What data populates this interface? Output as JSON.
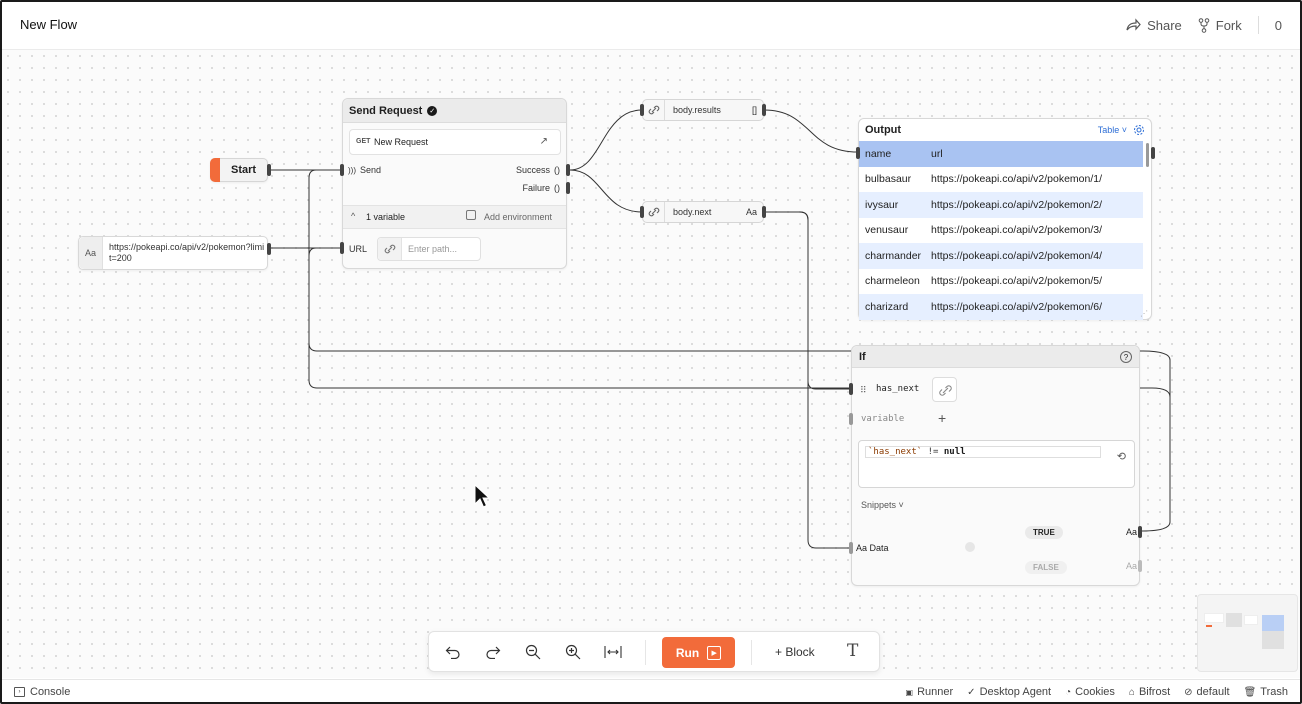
{
  "header": {
    "title": "New Flow",
    "share_label": "Share",
    "fork_label": "Fork",
    "count": "0"
  },
  "start_node": {
    "label": "Start"
  },
  "text_node": {
    "type_badge": "Aa",
    "value": "https://pokeapi.co/api/v2/pokemon?limit=200"
  },
  "send_request": {
    "title": "Send Request",
    "method": "GET",
    "request_name": "New Request",
    "send_label": "Send",
    "success_label": "Success",
    "success_type": "()",
    "failure_label": "Failure",
    "failure_type": "()",
    "variables_label": "1 variable",
    "add_env_label": "Add environment",
    "url_label": "URL",
    "path_placeholder": "Enter path..."
  },
  "body_results": {
    "label": "body.results",
    "type": "[]"
  },
  "body_next": {
    "label": "body.next",
    "type": "Aa"
  },
  "output": {
    "title": "Output",
    "view_mode": "Table",
    "columns": [
      "name",
      "url"
    ],
    "rows": [
      [
        "bulbasaur",
        "https://pokeapi.co/api/v2/pokemon/1/"
      ],
      [
        "ivysaur",
        "https://pokeapi.co/api/v2/pokemon/2/"
      ],
      [
        "venusaur",
        "https://pokeapi.co/api/v2/pokemon/3/"
      ],
      [
        "charmander",
        "https://pokeapi.co/api/v2/pokemon/4/"
      ],
      [
        "charmeleon",
        "https://pokeapi.co/api/v2/pokemon/5/"
      ],
      [
        "charizard",
        "https://pokeapi.co/api/v2/pokemon/6/"
      ]
    ]
  },
  "if_node": {
    "title": "If",
    "var1": "has_next",
    "var2_placeholder": "variable",
    "expression_a": "`has_next`",
    "expression_op": " != ",
    "expression_b": "null",
    "snippets_label": "Snippets",
    "data_label": "Aa Data",
    "true_label": "TRUE",
    "false_label": "FALSE",
    "out_type": "Aa"
  },
  "toolbar": {
    "run_label": "Run",
    "block_label": "+ Block"
  },
  "footer": {
    "console_label": "Console",
    "items": [
      "Runner",
      "Desktop Agent",
      "Cookies",
      "Bifrost",
      "default",
      "Trash"
    ]
  },
  "colors": {
    "accent": "#f26b3a",
    "header_row": "#a9c3f2",
    "alt_row": "#e6efff"
  }
}
